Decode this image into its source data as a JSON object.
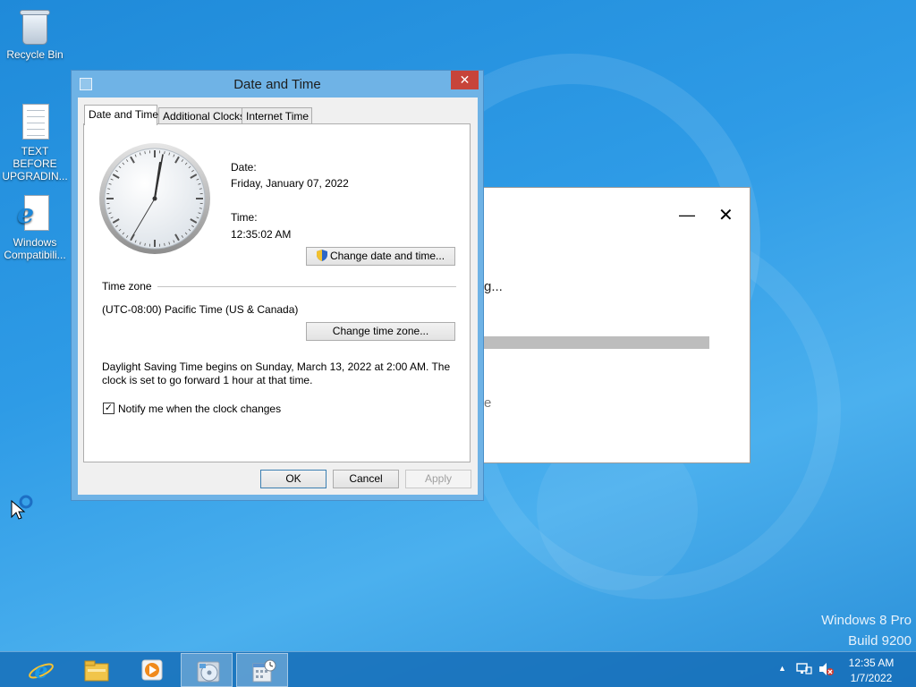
{
  "desktop": {
    "icons": [
      {
        "label": "Recycle Bin",
        "icon": "recycle-bin-icon"
      },
      {
        "label": "TEXT BEFORE UPGRADIN...",
        "icon": "text-document-icon"
      },
      {
        "label": "Windows Compatibili...",
        "icon": "internet-explorer-shortcut-icon"
      }
    ],
    "watermark": {
      "line1": "Windows 8 Pro",
      "line2": "Build 9200"
    }
  },
  "background_window": {
    "minimize": "—",
    "close": "✕",
    "partial_text_1": "g...",
    "partial_text_2": "e"
  },
  "dialog": {
    "title": "Date and Time",
    "close": "✕",
    "tabs": [
      {
        "label": "Date and Time",
        "active": true
      },
      {
        "label": "Additional Clocks",
        "active": false
      },
      {
        "label": "Internet Time",
        "active": false
      }
    ],
    "date_label": "Date:",
    "date_value": "Friday, January 07, 2022",
    "time_label": "Time:",
    "time_value": "12:35:02 AM",
    "change_datetime_button": "Change date and time...",
    "timezone_header": "Time zone",
    "timezone_value": "(UTC-08:00) Pacific Time (US & Canada)",
    "change_timezone_button": "Change time zone...",
    "dst_line1": "Daylight Saving Time begins on Sunday, March 13, 2022 at 2:00 AM. The",
    "dst_line2": "clock is set to go forward 1 hour at that time.",
    "notify_checkbox": {
      "label": "Notify me when the clock changes",
      "checked": true
    },
    "ok_button": "OK",
    "cancel_button": "Cancel",
    "apply_button": "Apply"
  },
  "taskbar": {
    "apps": [
      {
        "icon": "internet-explorer-icon",
        "active": false
      },
      {
        "icon": "file-explorer-icon",
        "active": false
      },
      {
        "icon": "media-player-icon",
        "active": false
      },
      {
        "icon": "disc-setup-icon",
        "active": true
      },
      {
        "icon": "date-time-icon",
        "active": true
      }
    ],
    "tray": {
      "time": "12:35 AM",
      "date": "1/7/2022"
    }
  },
  "colors": {
    "desktop_bg": "#2e9be6",
    "dialog_frame": "#6fb3e6",
    "close_button": "#c7443a",
    "taskbar": "#166eb9"
  }
}
